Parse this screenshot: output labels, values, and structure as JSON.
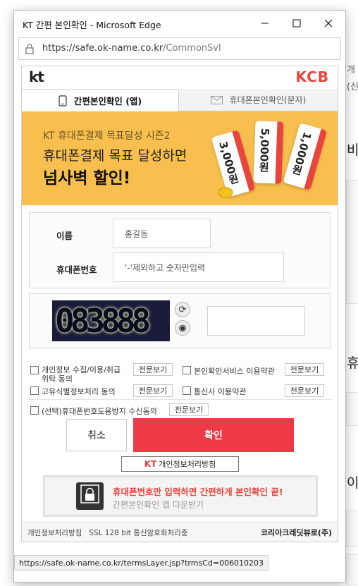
{
  "window": {
    "title": "KT 간편 본인확인 - Microsoft Edge",
    "url_host": "https://safe.ok-name.co.kr",
    "url_path": "/CommonSvl"
  },
  "brand": {
    "left_logo": "kt",
    "right_logo": "KCB"
  },
  "tabs": [
    {
      "label": "간편본인확인 (앱)",
      "icon": "phone-icon",
      "active": true
    },
    {
      "label": "휴대폰본인확인(문자)",
      "icon": "envelope-icon",
      "active": false
    }
  ],
  "banner": {
    "subtitle": "KT 휴대폰결제 목표달성 시즌2",
    "line1": "휴대폰결제 목표 달성하면",
    "line2": "넘사벽 할인!",
    "coupons": [
      "3,000원",
      "5,000원",
      "1,000원"
    ],
    "bg_color": "#f8bf4e"
  },
  "form": {
    "name_label": "이름",
    "name_placeholder": "홍길동",
    "phone_label": "휴대폰번호",
    "phone_placeholder": "'-'제외하고 숫자만입력"
  },
  "captcha": {
    "text": "083888",
    "refresh_icon": "refresh-icon",
    "audio_icon": "speaker-icon"
  },
  "agreements": [
    {
      "label": "개인정보 수집/이용/취급 위탁 동의",
      "view": "전문보기"
    },
    {
      "label": "본인확인서비스 이용약관",
      "view": "전문보기"
    },
    {
      "label": "고유식별정보처리 동의",
      "view": "전문보기"
    },
    {
      "label": "통신사 이용약관",
      "view": "전문보기"
    },
    {
      "label": "(선택)휴대폰번호도용방지 수신동의",
      "view": "전문보기"
    }
  ],
  "buttons": {
    "cancel": "취소",
    "confirm": "확인",
    "confirm_color": "#ee3a46"
  },
  "privacy_policy": {
    "prefix": "KT",
    "label": "개인정보처리방침"
  },
  "app_banner": {
    "line1": "휴대폰번호만 입력하면 간편하게 본인확인 끝!",
    "line2": "간편본인확인 앱 다운받기"
  },
  "footer": {
    "left": "개인정보처리방침   SSL 128 bit 통신암호화처리중",
    "right": "코리아크레딧뷰로(주)"
  },
  "statusbar": {
    "link": "https://safe.ok-name.co.kr/termsLayer.jsp?trmsCd=006010203"
  },
  "background_page": {
    "t1": "개",
    "t2": "(신",
    "t3": "비",
    "t4": "휴",
    "t5": "이"
  }
}
